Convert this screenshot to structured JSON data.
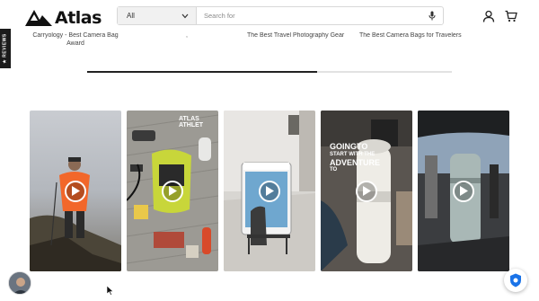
{
  "header": {
    "logo_text": "Atlas",
    "search_category": "All",
    "search_placeholder": "Search for"
  },
  "reviews_tab": {
    "label": "REVIEWS"
  },
  "related": [
    {
      "line1": "Carryology - Best Camera Bag",
      "line2": "Award"
    },
    {
      "line1": "The Best Travel Photography Gear",
      "line2": ""
    },
    {
      "line1": "The Best Camera Bags for Travelers",
      "line2": ""
    }
  ],
  "carousel": {
    "progress_percent": 63
  },
  "videos": [
    {
      "name": "hiker-video",
      "overlay": ""
    },
    {
      "name": "gear-flatlay-video",
      "overlay": "ATLAS ATHLET"
    },
    {
      "name": "airport-video",
      "overlay": ""
    },
    {
      "name": "lens-adventure-video",
      "overlay_1": "GOINGTO",
      "overlay_2": "START WITH THE",
      "overlay_3": "ADVENTURE",
      "overlay_4": "TO"
    },
    {
      "name": "car-trunk-video",
      "overlay": ""
    }
  ],
  "colors": {
    "accent": "#111111",
    "play_ring": "#ffffff",
    "chat_blue": "#1a73e8"
  }
}
